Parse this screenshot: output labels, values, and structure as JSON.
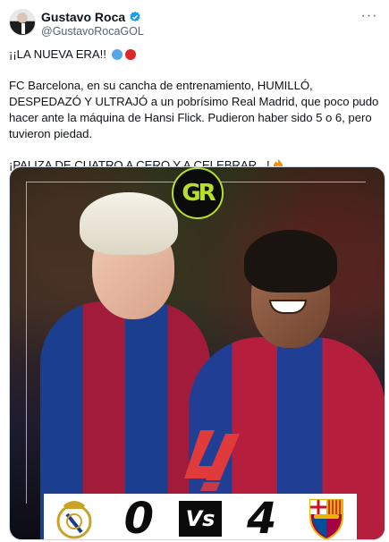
{
  "author": {
    "display_name": "Gustavo Roca",
    "handle": "@GustavoRocaGOL",
    "verified": true
  },
  "tweet": {
    "line1": "¡¡LA NUEVA ERA!!",
    "paragraph1": "FC Barcelona, en su cancha de entrenamiento, HUMILLÓ, DESPEDAZÓ Y ULTRAJÓ a un pobrísimo Real Madrid, que poco pudo hacer ante la máquina de Hansi Flick. Pudieron haber sido 5 o 6, pero tuvieron piedad.",
    "paragraph2": "¡PALIZA DE CUATRO A CERO Y A CELEBRAR...!"
  },
  "media": {
    "logo_text": "GR",
    "home_score": "0",
    "vs_label": "Vs",
    "away_score": "4"
  },
  "icons": {
    "more": "more-horizontal-icon",
    "verified": "verified-badge-icon",
    "fire": "fire-emoji-icon"
  },
  "colors": {
    "accent_blue": "#1d9bf0",
    "dot_blue": "#55a6ea",
    "dot_red": "#e0242c",
    "logo_green": "#b8e02a",
    "laliga_red": "#e03a3a"
  }
}
